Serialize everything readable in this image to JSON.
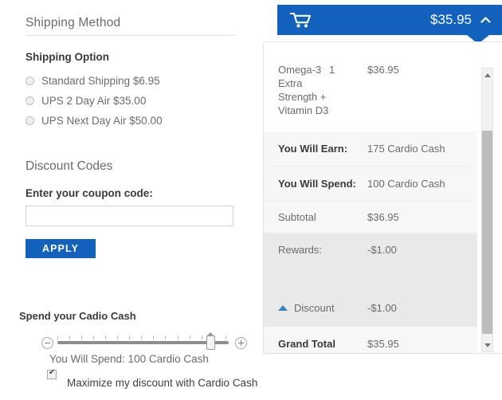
{
  "left": {
    "section_title": "Shipping Method",
    "shipping_option_label": "Shipping Option",
    "shipping_options": [
      {
        "label": "Standard Shipping $6.95",
        "selected": false
      },
      {
        "label": "UPS 2 Day Air $35.00",
        "selected": false
      },
      {
        "label": "UPS Next Day Air $50.00",
        "selected": false
      }
    ],
    "discount_title": "Discount Codes",
    "coupon_label": "Enter your coupon code:",
    "coupon_value": "",
    "coupon_placeholder": "",
    "apply_label": "APPLY",
    "cardio": {
      "title": "Spend your Cadio Cash",
      "minus_icon": "minus-circle-icon",
      "plus_icon": "plus-circle-icon",
      "slider_value": 100,
      "slider_max": 100,
      "spend_text": "You Will Spend: 100 Cardio Cash",
      "maximize_label": "Maximize my discount with Cardio Cash",
      "maximize_checked": true
    }
  },
  "cart_bar": {
    "icon": "shopping-cart-icon",
    "total": "$35.95",
    "chevron": "chevron-up-icon"
  },
  "summary": {
    "product": {
      "name": "Omega-3 Extra Strength + Vitamin D3",
      "qty": "1",
      "price": "$36.95"
    },
    "rows": [
      {
        "label": "You Will Earn:",
        "value": "175 Cardio Cash",
        "bold": true
      },
      {
        "label": "You Will Spend:",
        "value": "100 Cardio Cash",
        "bold": true
      },
      {
        "label": "Subtotal",
        "value": "$36.95",
        "bold": false
      },
      {
        "label": "Rewards:",
        "value": "-$1.00",
        "bold": false
      },
      {
        "label": "Discount",
        "value": "-$1.00",
        "bold": false
      },
      {
        "label": "Grand Total",
        "value": "$35.95",
        "bold": true
      }
    ],
    "discount_caret": "triangle-up-icon"
  },
  "scrollbar": {
    "up_icon": "scroll-up-arrow-icon",
    "down_icon": "scroll-down-arrow-icon"
  },
  "colors": {
    "accent_blue": "#1161bd",
    "caret_blue": "#2e86c9",
    "row_shaded": "#f7f7f7",
    "row_block": "#e9e9e9"
  }
}
